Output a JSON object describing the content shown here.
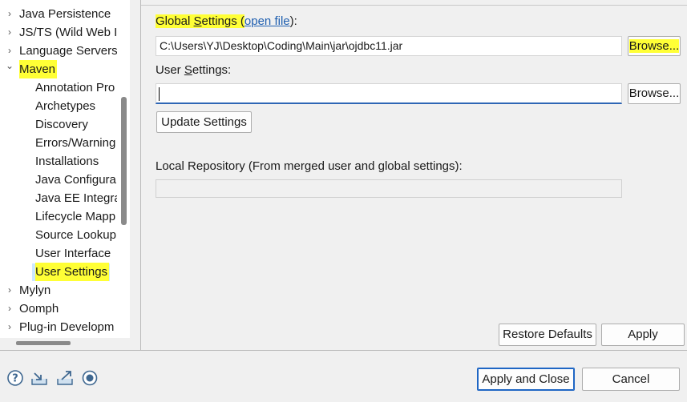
{
  "tree": {
    "items": [
      {
        "label": "Java Persistence",
        "arrow": "›",
        "level": 0
      },
      {
        "label": "JS/TS (Wild Web I",
        "arrow": "›",
        "level": 0
      },
      {
        "label": "Language Servers",
        "arrow": "›",
        "level": 0
      },
      {
        "label": "Maven",
        "arrow": "⌄",
        "level": 0
      },
      {
        "label": "Annotation Pro",
        "level": 1
      },
      {
        "label": "Archetypes",
        "level": 1
      },
      {
        "label": "Discovery",
        "level": 1
      },
      {
        "label": "Errors/Warning",
        "level": 1
      },
      {
        "label": "Installations",
        "level": 1
      },
      {
        "label": "Java Configura",
        "level": 1
      },
      {
        "label": "Java EE Integra",
        "level": 1
      },
      {
        "label": "Lifecycle Mapp",
        "level": 1
      },
      {
        "label": "Source Lookup",
        "level": 1
      },
      {
        "label": "User Interface",
        "level": 1
      },
      {
        "label": "User Settings",
        "level": 1
      },
      {
        "label": "Mylyn",
        "arrow": "›",
        "level": 0
      },
      {
        "label": "Oomph",
        "arrow": "›",
        "level": 0
      },
      {
        "label": "Plug-in Developm",
        "arrow": "›",
        "level": 0
      }
    ],
    "highlight_color": "#ffff36",
    "selected_color": "#cce8ff"
  },
  "global_settings": {
    "label_prefix": "Global ",
    "label_underlined": "S",
    "label_rest": "ettings (",
    "link": "open file",
    "label_suffix": "):",
    "value": "C:\\Users\\YJ\\Desktop\\Coding\\Main\\jar\\ojdbc11.jar",
    "browse_label": "Browse..."
  },
  "user_settings": {
    "label_prefix": "User ",
    "label_underlined": "S",
    "label_rest": "ettings:",
    "value": "",
    "browse_label": "Browse...",
    "update_label": "Update Settings"
  },
  "local_repository": {
    "label": "Local Repository (From merged user and global settings):",
    "value": ""
  },
  "buttons": {
    "restore_defaults": "Restore Defaults",
    "apply": "Apply",
    "apply_and_close": "Apply and Close",
    "cancel": "Cancel"
  },
  "bottom_icons": [
    "help-icon",
    "import-icon",
    "export-icon",
    "record-icon"
  ]
}
